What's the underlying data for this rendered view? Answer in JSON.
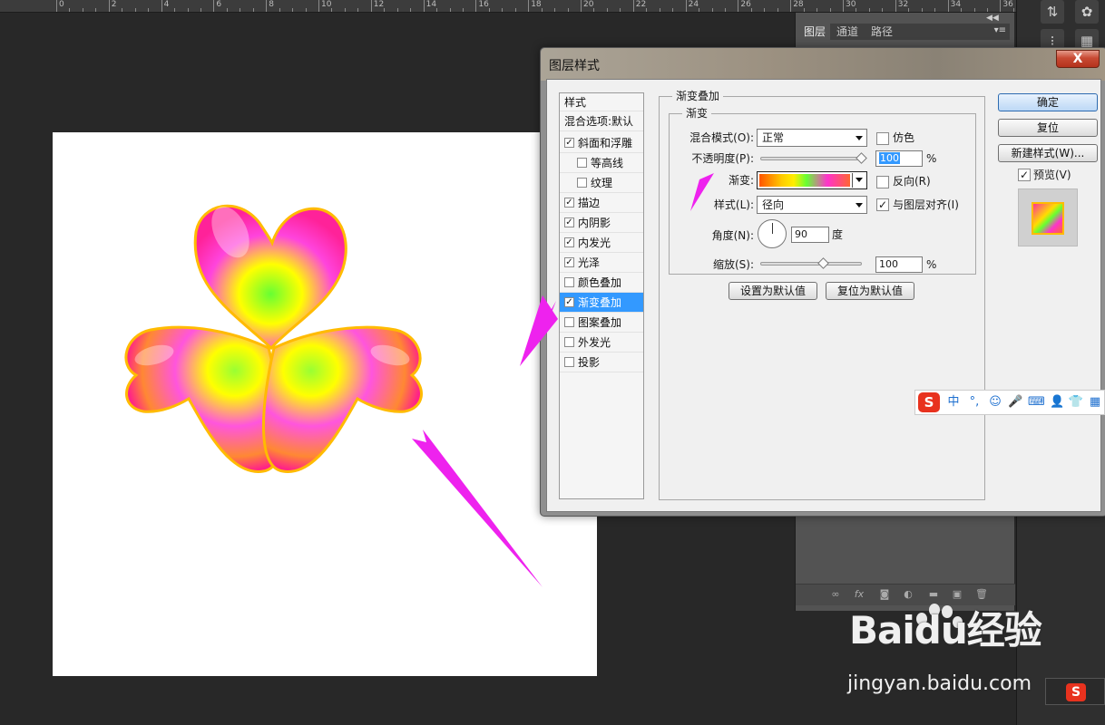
{
  "ruler": {
    "numbers": [
      "0",
      "2",
      "4",
      "6",
      "8",
      "10",
      "12",
      "14",
      "16",
      "18",
      "20",
      "22",
      "24",
      "26",
      "28",
      "30",
      "32",
      "34",
      "36"
    ]
  },
  "panel": {
    "tabs": [
      "图层",
      "通道",
      "路径"
    ],
    "collapse_label": "◀◀",
    "menu_label": "▾≡"
  },
  "dialog": {
    "title": "图层样式",
    "close_label": "X",
    "styles_header": "样式",
    "blend_options": "混合选项:默认",
    "items": [
      {
        "label": "斜面和浮雕",
        "checked": true
      },
      {
        "label": "等高线",
        "checked": false
      },
      {
        "label": "纹理",
        "checked": false
      },
      {
        "label": "描边",
        "checked": true
      },
      {
        "label": "内阴影",
        "checked": true
      },
      {
        "label": "内发光",
        "checked": true
      },
      {
        "label": "光泽",
        "checked": true
      },
      {
        "label": "颜色叠加",
        "checked": false
      },
      {
        "label": "渐变叠加",
        "checked": true,
        "selected": true
      },
      {
        "label": "图案叠加",
        "checked": false
      },
      {
        "label": "外发光",
        "checked": false
      },
      {
        "label": "投影",
        "checked": false
      }
    ],
    "group_title": "渐变叠加",
    "inner_title": "渐变",
    "blend_mode_label": "混合模式(O):",
    "blend_mode_value": "正常",
    "dither_label": "仿色",
    "dither_checked": false,
    "opacity_label": "不透明度(P):",
    "opacity_value": "100",
    "percent": "%",
    "gradient_label": "渐变:",
    "reverse_label": "反向(R)",
    "reverse_checked": false,
    "style_label": "样式(L):",
    "style_value": "径向",
    "align_label": "与图层对齐(I)",
    "align_checked": true,
    "angle_label": "角度(N):",
    "angle_value": "90",
    "angle_unit": "度",
    "scale_label": "缩放(S):",
    "scale_value": "100",
    "set_default_btn": "设置为默认值",
    "reset_default_btn": "复位为默认值",
    "ok_btn": "确定",
    "reset_btn": "复位",
    "new_style_btn": "新建样式(W)...",
    "preview_label": "预览(V)",
    "preview_checked": true
  },
  "ime": {
    "logo": "S",
    "items": [
      "中",
      "°,",
      "☺",
      "🎤",
      "⌨",
      "👤",
      "👕",
      "▦"
    ]
  },
  "watermark": {
    "brand": "Baidu经验",
    "url": "jingyan.baidu.com"
  },
  "colors": {
    "accent": "#3399ff",
    "arrow": "#ee22ee",
    "gradient": [
      "#ff5500",
      "#ffee00",
      "#66ff33",
      "#ff33cc",
      "#ff6633"
    ],
    "ime_red": "#e8321e"
  }
}
